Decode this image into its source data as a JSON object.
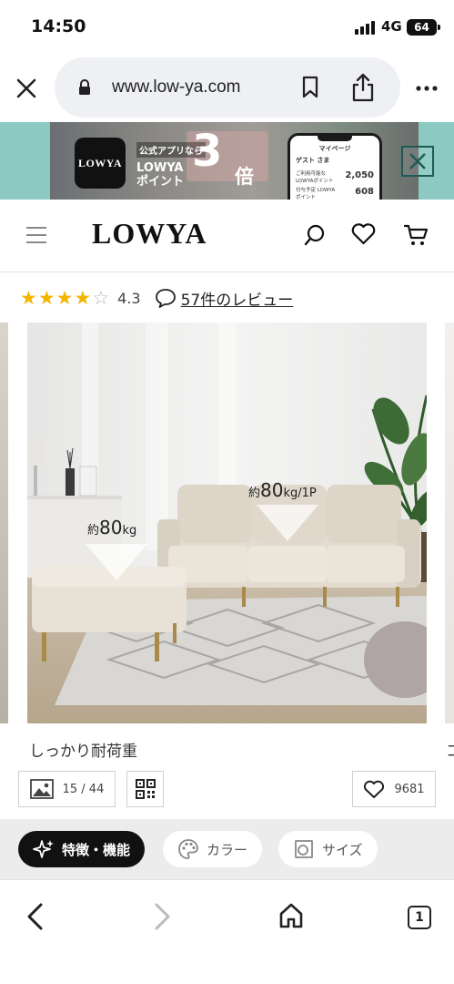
{
  "status_bar": {
    "time": "14:50",
    "network": "4G",
    "battery": "64"
  },
  "browser": {
    "url": "www.low-ya.com",
    "tab_count": "1"
  },
  "app_banner": {
    "line_small": "公式アプリなら",
    "line_name": "LOWYA",
    "line_points": "ポイント",
    "multiplier": "3",
    "multiplier_unit": "倍",
    "logo_text": "LOWYA",
    "phone": {
      "header": "マイページ",
      "name": "ゲスト さま",
      "row1_label": "ご利用可能な LOWYAポイント",
      "row1_value": "2,050",
      "row2_label": "付与予定 LOWYAポイント",
      "row2_value": "608"
    }
  },
  "header": {
    "logo": "LOWYA"
  },
  "rating": {
    "stars_full": 4,
    "stars_total": 5,
    "value": "4.3",
    "reviews_link": "57件のレビュー"
  },
  "product_image": {
    "label_ottoman_prefix": "約",
    "label_ottoman_value": "80",
    "label_ottoman_unit": "kg",
    "label_sofa_prefix": "約",
    "label_sofa_value": "80",
    "label_sofa_unit": "kg/1P"
  },
  "caption": "しっかり耐荷重",
  "caption_next": "コ",
  "image_counter": "15 / 44",
  "favorites_count": "9681",
  "tabs": [
    {
      "label": "特徴・機能",
      "icon": "sparkle-icon",
      "active": true
    },
    {
      "label": "カラー",
      "icon": "palette-icon",
      "active": false
    },
    {
      "label": "サイズ",
      "icon": "size-icon",
      "active": false
    }
  ],
  "colors": {
    "banner_bg": "#8bc9c2",
    "star": "#f2b600",
    "active_tab": "#111111"
  }
}
